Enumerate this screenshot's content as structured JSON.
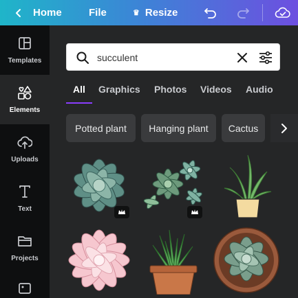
{
  "topbar": {
    "home_label": "Home",
    "file_label": "File",
    "resize_label": "Resize",
    "back_icon": "chevron-left-icon",
    "undo_icon": "undo-icon",
    "redo_icon": "redo-icon",
    "cloud_icon": "cloud-saved-icon"
  },
  "sidebar": {
    "items": [
      {
        "label": "Templates",
        "icon": "templates-icon"
      },
      {
        "label": "Elements",
        "icon": "elements-icon",
        "active": true
      },
      {
        "label": "Uploads",
        "icon": "upload-cloud-icon"
      },
      {
        "label": "Text",
        "icon": "text-icon"
      },
      {
        "label": "Projects",
        "icon": "folder-icon"
      }
    ]
  },
  "search": {
    "value": "succulent",
    "icon": "search-icon",
    "clear_icon": "close-icon",
    "filter_icon": "filter-sliders-icon"
  },
  "tabs": [
    "All",
    "Graphics",
    "Photos",
    "Videos",
    "Audio"
  ],
  "active_tab": "All",
  "chips": [
    "Potted plant",
    "Hanging plant",
    "Cactus"
  ],
  "results": [
    {
      "name": "echeveria-rosette",
      "premium": true
    },
    {
      "name": "succulent-cluster",
      "premium": true
    },
    {
      "name": "aloe-in-pot",
      "premium": false
    },
    {
      "name": "pink-echeveria",
      "premium": false
    },
    {
      "name": "haworthia-terracotta-pot",
      "premium": false
    },
    {
      "name": "succulent-in-bowl",
      "premium": false
    }
  ],
  "colors": {
    "accent": "#8b3dff",
    "panel": "#252627",
    "nav": "#0e0f10",
    "chip": "#3a3b3d"
  }
}
